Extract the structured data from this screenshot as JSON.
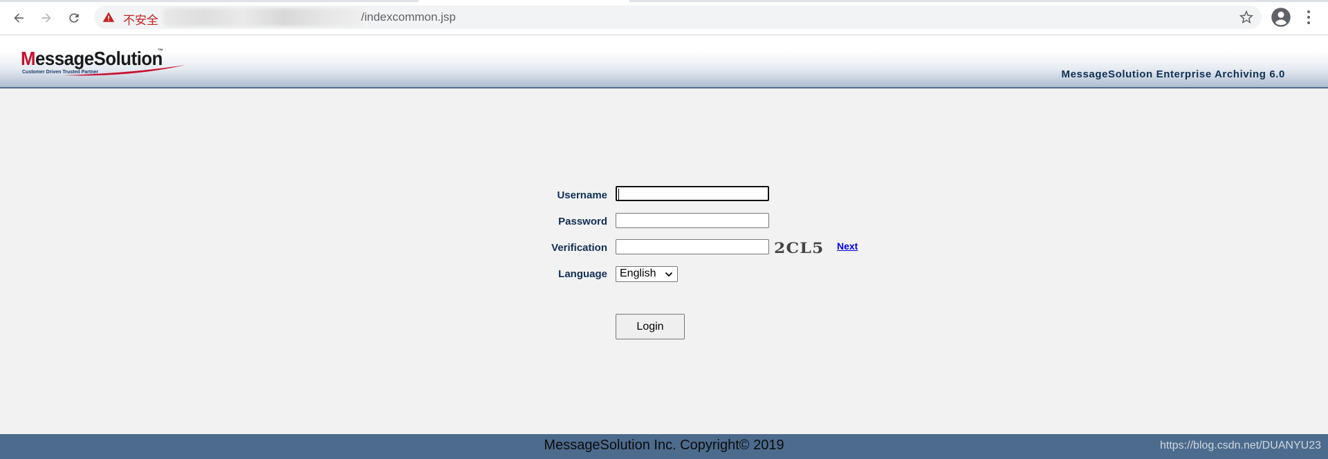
{
  "browser": {
    "security_label": "不安全",
    "url_path": "/indexcommon.jsp"
  },
  "header": {
    "logo_text_first": "M",
    "logo_text_rest": "essageSolution",
    "logo_trademark": "™",
    "logo_tagline": "Customer Driven Trusted Partner",
    "product_title": "MessageSolution Enterprise Archiving  6.0"
  },
  "form": {
    "username_label": "Username",
    "username_value": "",
    "password_label": "Password",
    "password_value": "",
    "verification_label": "Verification",
    "verification_value": "",
    "captcha_text": "2CL5",
    "next_link": "Next",
    "language_label": "Language",
    "language_selected": "English",
    "login_button": "Login"
  },
  "footer": {
    "copyright": "MessageSolution Inc. Copyright© 2019",
    "watermark": "https://blog.csdn.net/DUANYU23"
  },
  "colors": {
    "label": "#0f2f55",
    "footer_bg": "#4d6b8d",
    "link": "#0000ee",
    "insecure": "#c5221f"
  }
}
